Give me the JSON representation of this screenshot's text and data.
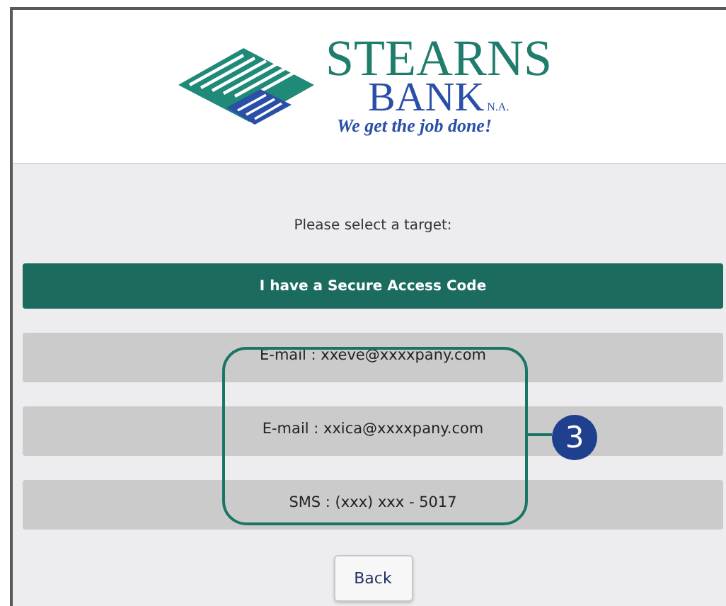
{
  "logo": {
    "name": "STEARNS",
    "subname": "BANK",
    "suffix": "N.A.",
    "tagline": "We get the job done!"
  },
  "prompt": "Please select a target:",
  "targets": [
    {
      "kind": "primary",
      "label": "I have a Secure Access Code"
    },
    {
      "kind": "secondary",
      "label": "E-mail : xxeve@xxxxpany.com"
    },
    {
      "kind": "secondary",
      "label": "E-mail : xxica@xxxxpany.com"
    },
    {
      "kind": "secondary",
      "label": "SMS : (xxx) xxx - 5017"
    }
  ],
  "back_button": "Back",
  "callout": {
    "number": "3"
  }
}
